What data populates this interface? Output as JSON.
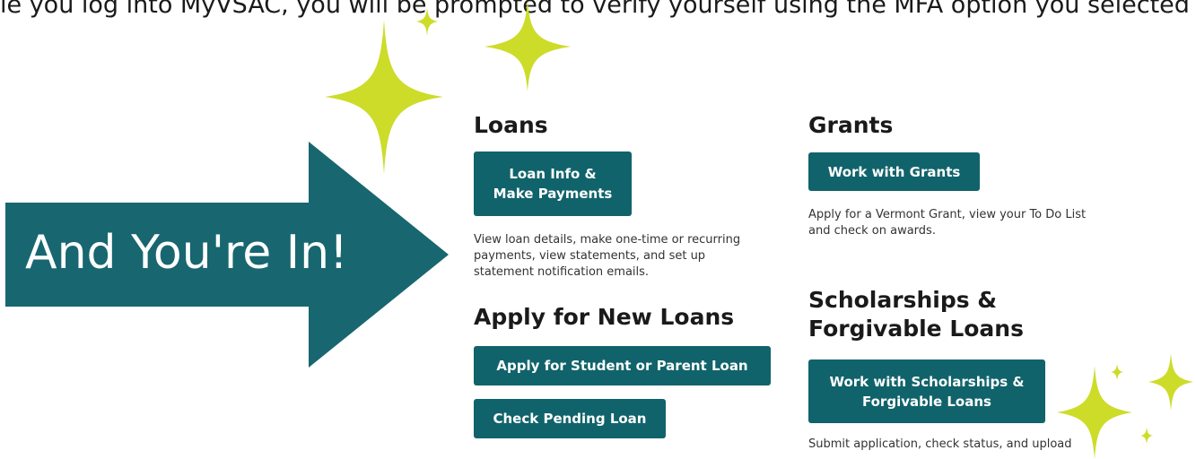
{
  "top_text": "le you log into MyVSAC, you will be prompted to verify yourself using the MFA option you selected",
  "callout": {
    "text": "And You're In!",
    "color": "#186670"
  },
  "accent_color": "#cddc29",
  "button_color": "#11636b",
  "sections": {
    "loans": {
      "heading": "Loans",
      "button": "Loan Info &\nMake Payments",
      "description": "View loan details, make one-time or recurring payments, view statements, and set up statement notification emails."
    },
    "apply": {
      "heading": "Apply for New Loans",
      "button_student_parent": "Apply for Student or Parent Loan",
      "button_pending": "Check Pending Loan"
    },
    "grants": {
      "heading": "Grants",
      "button": "Work with Grants",
      "description": "Apply for a Vermont Grant, view your To Do List and check on awards."
    },
    "scholarships": {
      "heading": "Scholarships &\nForgivable Loans",
      "button": "Work with Scholarships &\nForgivable Loans",
      "description": "Submit application, check status, and upload"
    }
  }
}
